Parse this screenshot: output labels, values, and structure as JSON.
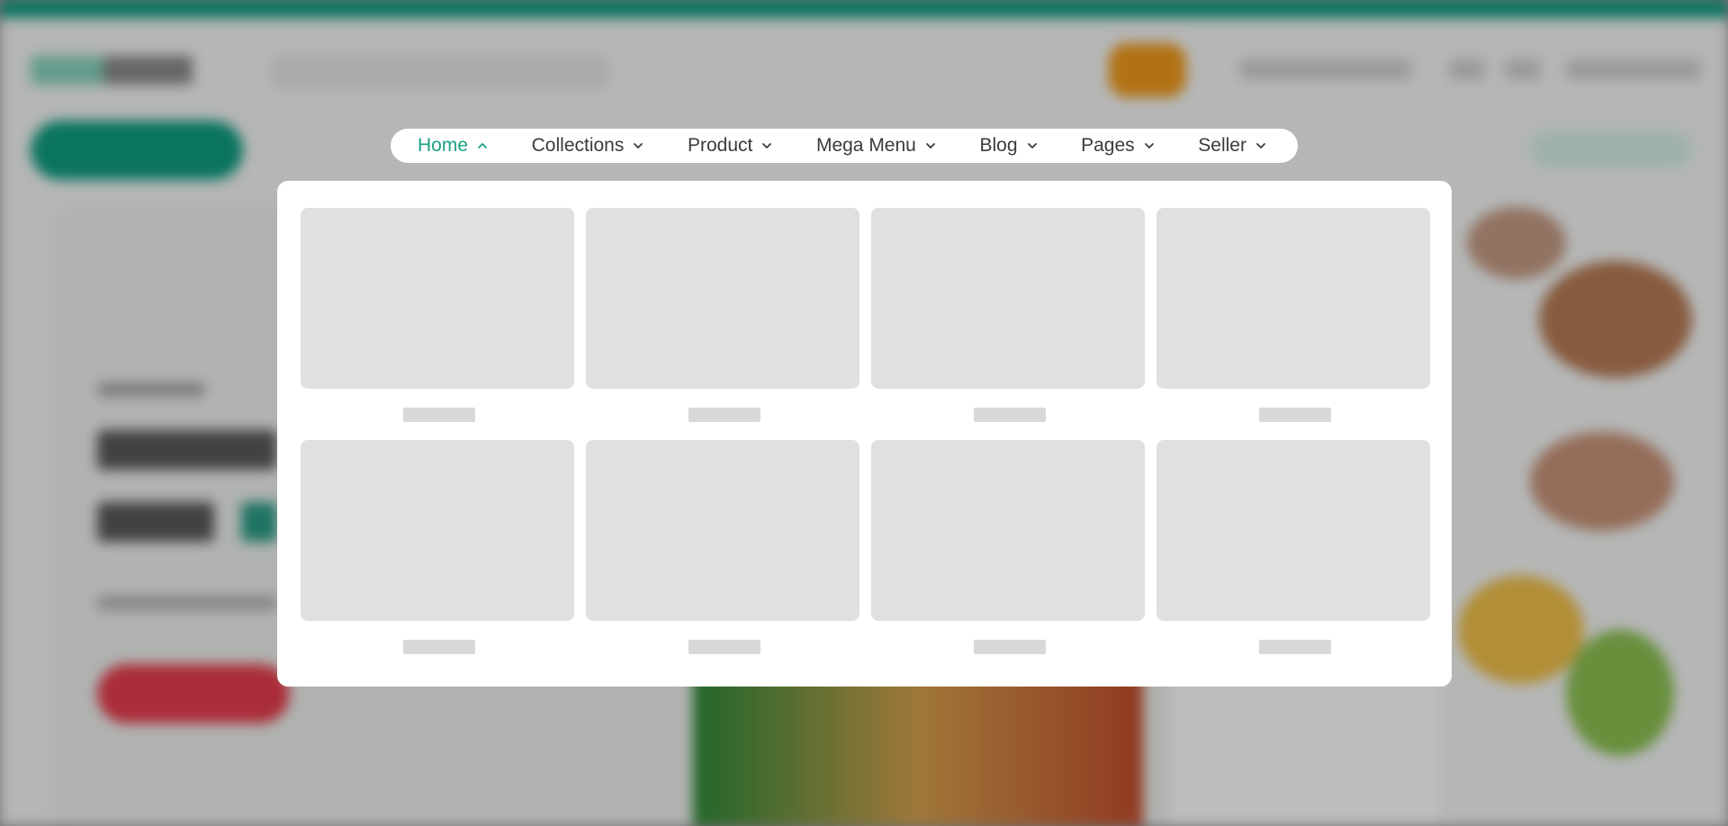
{
  "nav": {
    "items": [
      {
        "label": "Home",
        "chevron": "up",
        "active": true
      },
      {
        "label": "Collections",
        "chevron": "down",
        "active": false
      },
      {
        "label": "Product",
        "chevron": "down",
        "active": false
      },
      {
        "label": "Mega Menu",
        "chevron": "down",
        "active": false
      },
      {
        "label": "Blog",
        "chevron": "down",
        "active": false
      },
      {
        "label": "Pages",
        "chevron": "down",
        "active": false
      },
      {
        "label": "Seller",
        "chevron": "down",
        "active": false
      }
    ]
  },
  "dropdown": {
    "state": "loading",
    "placeholder_cards": 8,
    "columns": 4
  },
  "colors": {
    "accent": "#1aa184",
    "brand_green": "#0f9d82",
    "skeleton": "#e0e0e0",
    "overlay": "rgba(0,0,0,0.26)"
  },
  "icons": {
    "chevron_up": "chevron-up-icon",
    "chevron_down": "chevron-down-icon"
  }
}
